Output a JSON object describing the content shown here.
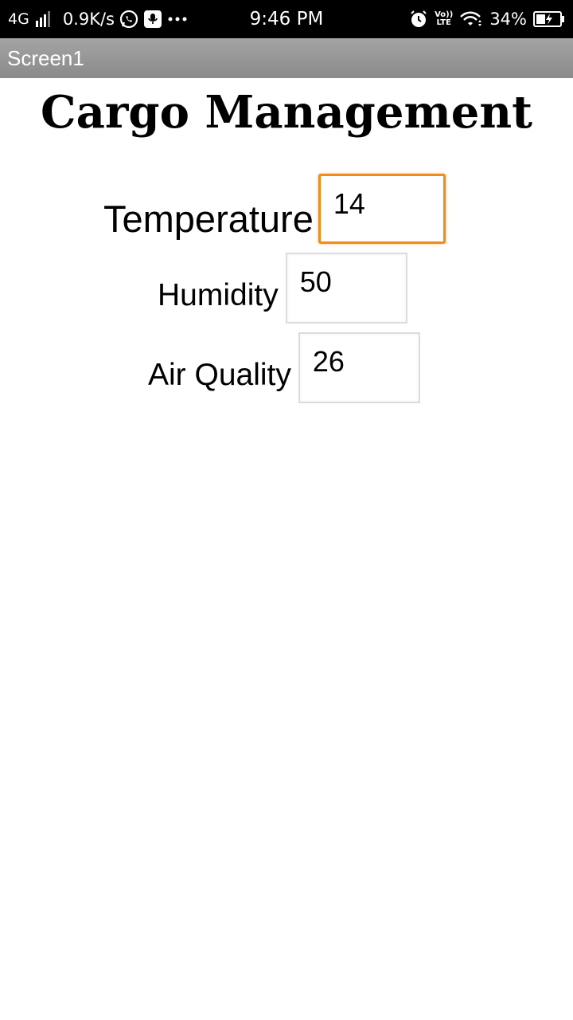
{
  "status_bar": {
    "network": "4G",
    "speed": "0.9K/s",
    "time": "9:46 PM",
    "volte_top": "Vo))",
    "volte_bottom": "LTE",
    "battery": "34%",
    "icons": [
      "signal-icon",
      "whatsapp-icon",
      "mic-notification-icon",
      "more-dots-icon",
      "alarm-icon",
      "volte-icon",
      "wifi-icon",
      "battery-charging-icon"
    ]
  },
  "title_bar": {
    "title": "Screen1"
  },
  "main": {
    "title": "Cargo Management",
    "fields": {
      "temperature": {
        "label": "Temperature",
        "value": "14",
        "focused": true
      },
      "humidity": {
        "label": "Humidity",
        "value": "50"
      },
      "air_quality": {
        "label": "Air Quality",
        "value": "26"
      }
    }
  },
  "colors": {
    "focus_border": "#f28c18",
    "title_bar": "#9a9a9a",
    "status_bar": "#000000"
  }
}
